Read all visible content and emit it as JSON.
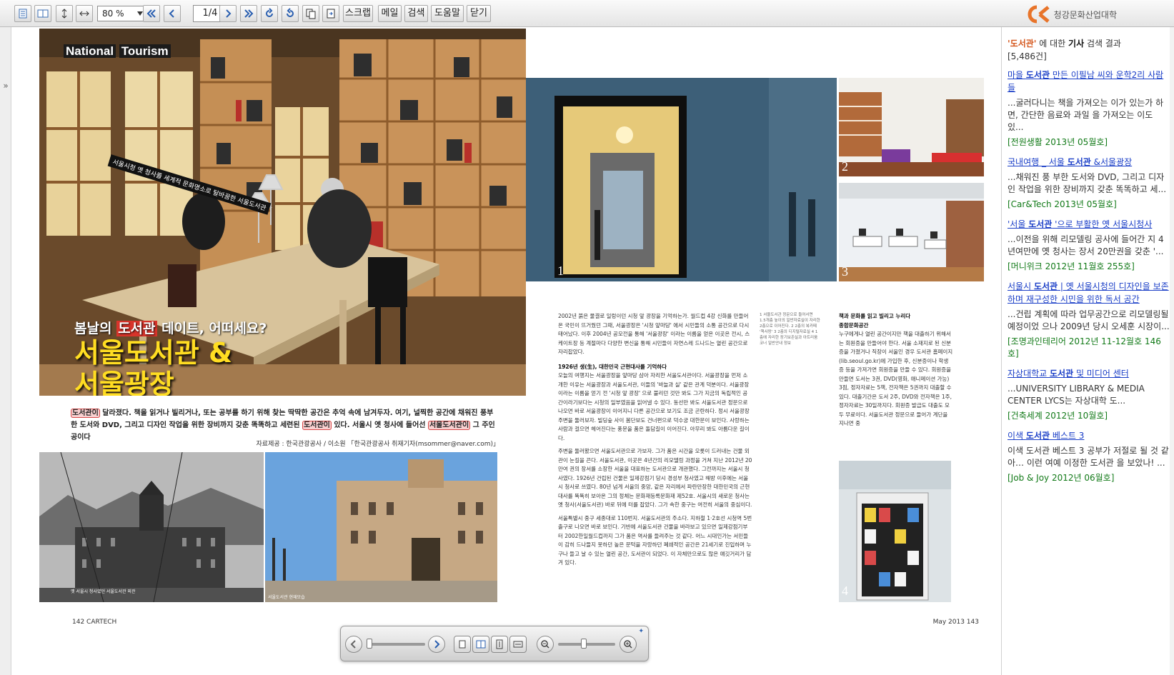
{
  "toolbar": {
    "zoom_value": "80 %",
    "page_indicator": "1/4",
    "buttons": [
      "스크랩",
      "메일",
      "검색",
      "도움말",
      "닫기"
    ],
    "brand": "청강문화산업대학"
  },
  "left_page": {
    "masthead_a": "National",
    "masthead_b": "Tourism",
    "hero_tag": "서울시청 옛 청사를 세계적 문화명소로 탈바꿈한 서울도서관",
    "subtitle_pre": "봄날의 ",
    "subtitle_hl": "도서관",
    "subtitle_post": " 데이트, 어떠세요?",
    "title_line1": "서울도서관 &",
    "title_line2": "서울광장",
    "intro_1": "도서관이",
    "intro_2": " 달라졌다. 책을 읽거나 빌리거나, 또는 공부를 하기 위해 찾는 딱딱한 공간은 추억 속에 남겨두자. 여기, 널찍한 공간에 채워진 풍부한 도서와 DVD, 그리고 디자인 작업을 위한 장비까지 갖춘 똑똑하고 세련된 ",
    "intro_3": "도서관이",
    "intro_4": " 있다. 서울시 옛 청사에 들어선 ",
    "intro_5": "서울도서관이",
    "intro_6": " 그 주인공이다",
    "credit": "자료제공 : 한국관광공사 / 이소원 「한국관광공사 취재기자(msommer@naver.com)」",
    "caption_bw": "옛 서울시 청사였던 서울도서관 외관",
    "caption_color": "서울도서관 현재모습",
    "folio": "142 CARTECH"
  },
  "right_page": {
    "photo_numbers": [
      "1",
      "2",
      "3",
      "4"
    ],
    "legend": "1 서울도서관 정문으로 들어서면 1.5개층 높이의 일반자료실이 자리한 2층으로 이어진다. 2 2층의 복카페 '책사랑' 3 2층의 디지털자료실 4 1층에 자리한 장기보존실과 아트리움 코너 일반안내 정보",
    "col1_para1": "2002년 붉은 물결로 일렁이던 시청 앞 광장을 기억하는가. 월드컵 4강 신화를 만들어 온 국민이 뜨거웠던 그때, 서울광장은 '시청 앞마당' 에서 시민들의 소통 공간으로 다시 태어났다. 이후 2004년 공모전을 통해 '서울광장' 이라는 이름을 얻은 이곳은 전시, 스케이트장 등 계절마다 다양한 변신을 통해 시민들이 자연스레 드나드는 열린 공간으로 자리잡았다.",
    "col1_heading": "1926년 생(生), 대한민국 근현대사를 기억하다",
    "col1_para2": "오늘의 여행지는 서울광장을 앞마당 삼아 자리한 서울도서관이다. 서울광장을 먼저 소개한 이유는 서울광장과 서울도서관, 이들의 '바늘과 실' 같은 관계 덕분이다. 서울광장이라는 이름을 얻기 전 '시청 앞 광장' 으로 불리던 것만 봐도 그가 지금의 독립적인 공간이라기보다는 시청의 일부였음을 읽어낼 수 있다. 동선만 봐도 서울도서관 정문으로 나오면 바로 서울광장이 이어지니 다른 공간으로 보기도 조금 곤란하다. 정시 서울광장 주변을 둘러보자. 빌딩숲 사이 봄단보도 건너편으로 덕수궁 대한문이 보인다. 사랑하는 사람과 걸으면 헤어진다는 풍문을 품은 돌담길이 이어진다. 아무리 봐도 아름다운 길이다.",
    "col1_para3": "주변을 둘러봤으면 서울도서관으로 가보자. 그가 품은 시간을 오롯이 드러내는 건물 외관이 눈길을 끈다. 서울도서관, 이곳은 4년간의 리모델링 과정을 거쳐 지난 2012년 20만여 권의 장서를 소장한 서울을 대표하는 도서관으로 개관했다. 그전까지는 서울시 청사였다. 1926년 건립된 건물은 일제강점기 당시 경성부 청사였고 해방 이후에는 서울시 청사로 쓰였다. 80년 넘게 서울의 중앙, 같은 자리에서 파란만장한 대한민국의 근현대사를 똑똑히 보아온 그의 정체는 문화재등록문화재 제52호. 서울시의 새로운 청사는 옛 청사(서울도서관) 바로 뒤에 터를 잡았다. 그가 속한 중구는 여전히 서울의 중심이다.",
    "col1_para4": "서울특별시 중구 세종대로 110번지. 서울도서관의 주소다. 지하철 1·2호선 시청역 5번 출구로 나오면 바로 보인다. 기반에 서울도서관 건물을 바라보고 있으면 일제강점기부터 2002한일월드컵까지 그가 품은 역사를 들려주는 것 같다. 어느 시대인가는 서민들이 감히 드나들지 못하던 높은 문턱을 자랑하던 폐쇄적인 공간은 21세기로 진입하며 누구나 들고 날 수 있는 열린 공간, 도서관이 되었다. 이 자체만으로도 많은 얘깃거리가 담겨 있다.",
    "col2_heading1": "책과 문화를 읽고 빌리고 누리다",
    "col2_heading2": "종합문화공간",
    "col2_para": "누구에게나 열린 공간이지만 책을 대출하기 위해서는 회원증을 만들어야 한다. 서울 소재지로 된 신분증을 가졌거나 직장이 서울인 경우 도서관 홈페이지(lib.seoul.go.kr)에 가입한 후, 신분증이나 학생증 등을 가져가면 회원증을 만들 수 있다. 회원증을 만들면 도서는 3권, DVD(영화, 애니메이션 가능) 3점, 정자자료는 5책, 전자책은 5권까지 대출할 수 있다. 대출기간은 도서 2주, DVD와 전자책은 1주, 정자자료는 30일까지다. 회원증 발급도 대출도 모두 무료이다. 서울도서관 정문으로 들어가 계단을 지나면 중",
    "folio": "May 2013  143"
  },
  "results": {
    "query": "'도서관'",
    "head_mid": " 에 대한 ",
    "head_bold": "기사",
    "head_tail": " 검색 결과",
    "count": "[5,486건]",
    "items": [
      {
        "t1": "마을 ",
        "tb": "도서관",
        "t2": " 만든 이필남 씨와 운학2리 사람들",
        "snippet": "...굴러다니는 책을 가져오는 이가 있는가 하면, 간단한 음료와 과일 을 가져오는 이도 있...",
        "source": "[전원생활 2013년 05월호]"
      },
      {
        "t1": "국내여행 _ 서울 ",
        "tb": "도서관",
        "t2": " &서울광장",
        "snippet": "...채워진 풍 부한 도서와 DVD, 그리고 디자인 작업을 위한 장비까지 갖춘 똑똑하고 세...",
        "source": "[Car&Tech 2013년 05월호]"
      },
      {
        "t1": "'서울 ",
        "tb": "도서관",
        "t2": " '으로 부활한 옛 서울시청사",
        "snippet": "...이전을 위해 리모델링 공사에 들어간 지 4년여만에 옛 청사는 장서 20만권을 갖춘 '...",
        "source": "[머니위크 2012년 11월호 255호]"
      },
      {
        "t1": "서울시 ",
        "tb": "도서관",
        "t2": " | 옛 서울시청의 디자인을 보존하며 재구성한 시민을 위한 독서 공간",
        "snippet": "...건립 계획에 따라 업무공간으로 리모델링될 예정이었 으나 2009년 당시 오세훈 시장이...",
        "source": "[조명과인테리어 2012년 11-12월호 146호]"
      },
      {
        "t1": "자상대학교 ",
        "tb": "도서관",
        "t2": " 및 미디어 센터",
        "snippet": "...UNIVERSITY LIBRARY & MEDIA CENTER LYCS는 자상대학 도...",
        "source": "[건축세계 2012년 10월호]"
      },
      {
        "t1": "이색 ",
        "tb": "도서관",
        "t2": " 베스트 3",
        "snippet": "이색 도서관 베스트 3 공부가 저절로 될 것 같아… 이런 여예 이정한 도서관 을 보았나! ...",
        "source": "[Job & Joy 2012년 06월호]"
      }
    ]
  }
}
